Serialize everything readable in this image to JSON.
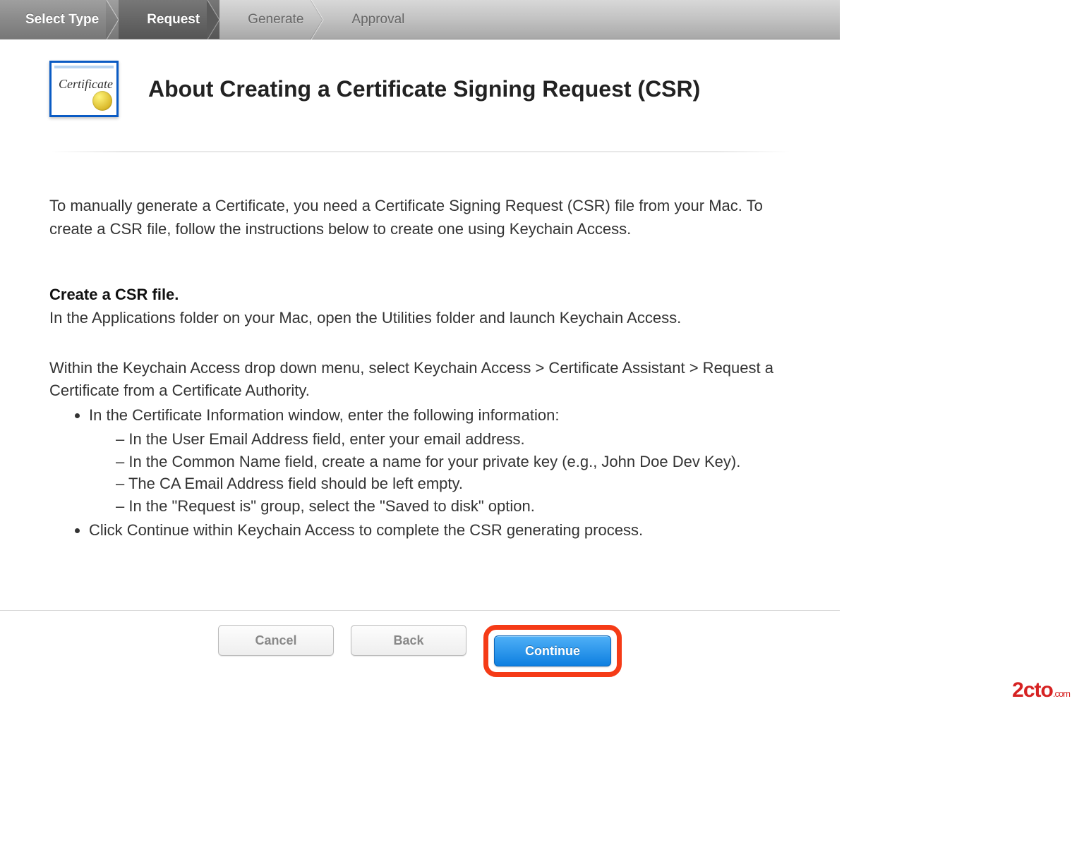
{
  "wizard": {
    "steps": [
      {
        "label": "Select Type",
        "state": "completed"
      },
      {
        "label": "Request",
        "state": "active"
      },
      {
        "label": "Generate",
        "state": "upcoming"
      },
      {
        "label": "Approval",
        "state": "upcoming"
      }
    ]
  },
  "header": {
    "cert_badge_text": "Certificate",
    "title": "About Creating a Certificate Signing Request (CSR)"
  },
  "content": {
    "intro": "To manually generate a Certificate, you need a Certificate Signing Request (CSR) file from your Mac. To create a CSR file, follow the instructions below to create one using Keychain Access.",
    "section_heading": "Create a CSR file.",
    "section_sub": "In the Applications folder on your Mac, open the Utilities folder and launch Keychain Access.",
    "menu_path": "Within the Keychain Access drop down menu, select Keychain Access > Certificate Assistant > Request a Certificate from a Certificate Authority.",
    "bullets": {
      "b1": "In the Certificate Information window, enter the following information:",
      "dashes": {
        "d1": "In the User Email Address field, enter your email address.",
        "d2": "In the Common Name field, create a name for your private key (e.g., John Doe Dev Key).",
        "d3": "The CA Email Address field should be left empty.",
        "d4": "In the \"Request is\" group, select the \"Saved to disk\" option."
      },
      "b2": "Click Continue within Keychain Access to complete the CSR generating process."
    }
  },
  "buttons": {
    "cancel": "Cancel",
    "back": "Back",
    "continue": "Continue"
  },
  "watermark": {
    "main": "2cto",
    "suffix": ".com"
  }
}
